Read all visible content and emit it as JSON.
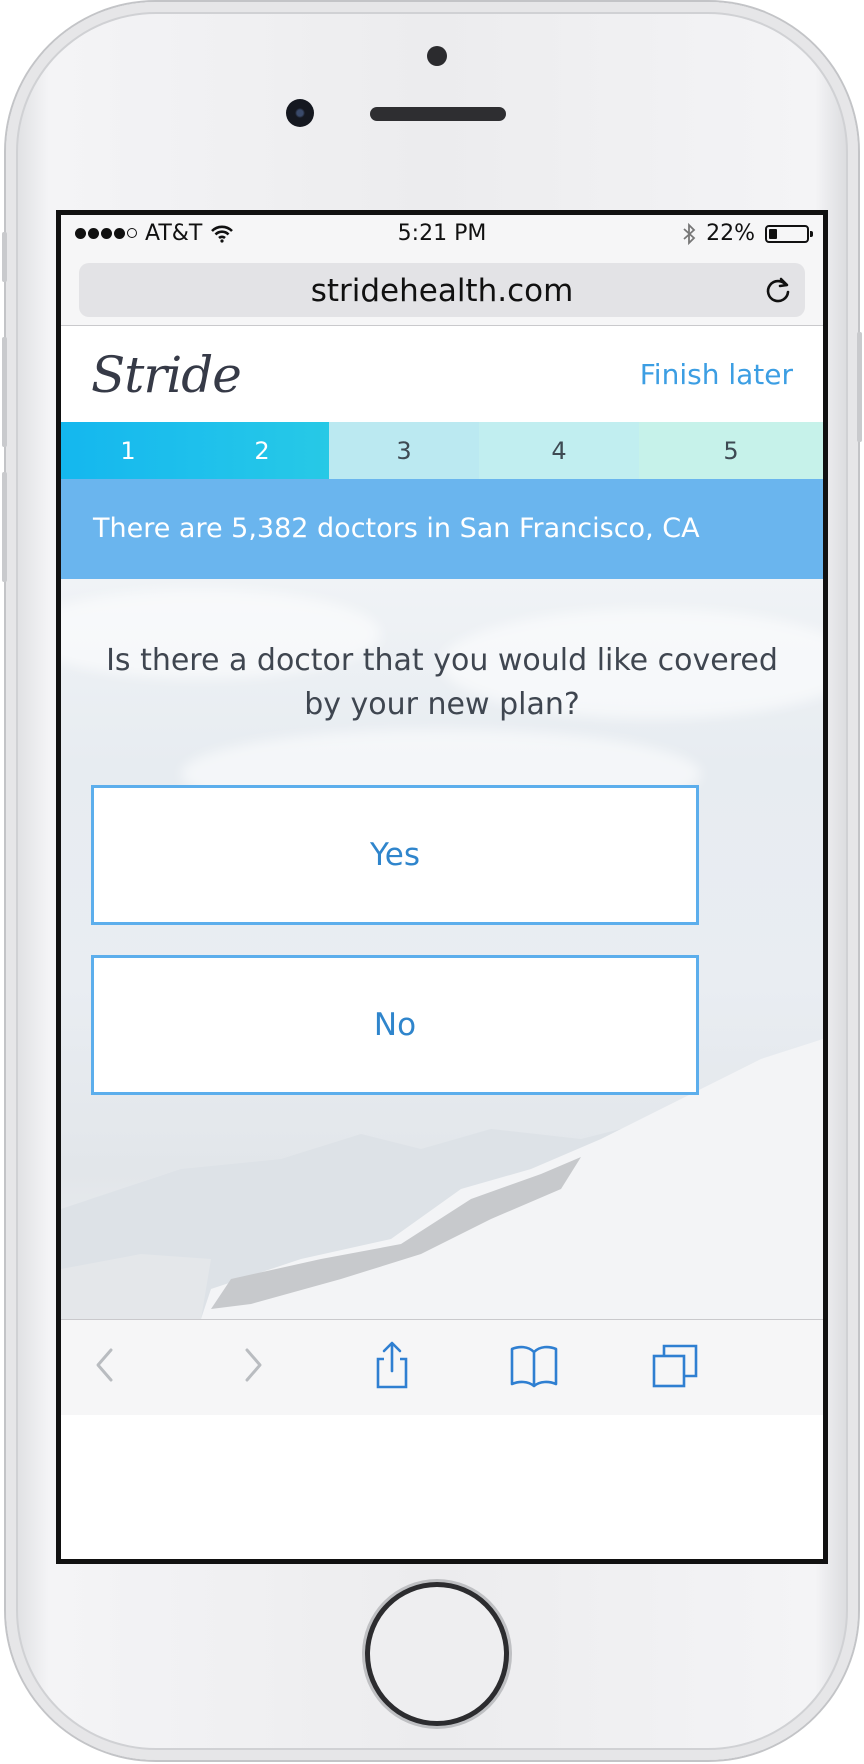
{
  "status_bar": {
    "carrier": "AT&T",
    "time": "5:21 PM",
    "battery": "22%",
    "battery_level": 0.22
  },
  "browser": {
    "url": "stridehealth.com"
  },
  "header": {
    "logo": "Stride",
    "finish_later": "Finish later"
  },
  "steps": [
    {
      "label": "1",
      "state": "done"
    },
    {
      "label": "2",
      "state": "done"
    },
    {
      "label": "3",
      "state": "todo"
    },
    {
      "label": "4",
      "state": "todo"
    },
    {
      "label": "5",
      "state": "todo"
    }
  ],
  "banner": {
    "text": "There are 5,382 doctors in San Francisco, CA"
  },
  "question": {
    "text": "Is there a doctor that you would like covered by your new plan?"
  },
  "choices": {
    "yes": "Yes",
    "no": "No"
  },
  "toolbar": {
    "icons": [
      "back-icon",
      "forward-icon",
      "share-icon",
      "bookmarks-icon",
      "tabs-icon"
    ]
  },
  "colors": {
    "accent": "#3c9ee3",
    "banner": "#6ab5ee",
    "step_done": "#1fc3ea",
    "step_todo": "#c3eef2"
  }
}
